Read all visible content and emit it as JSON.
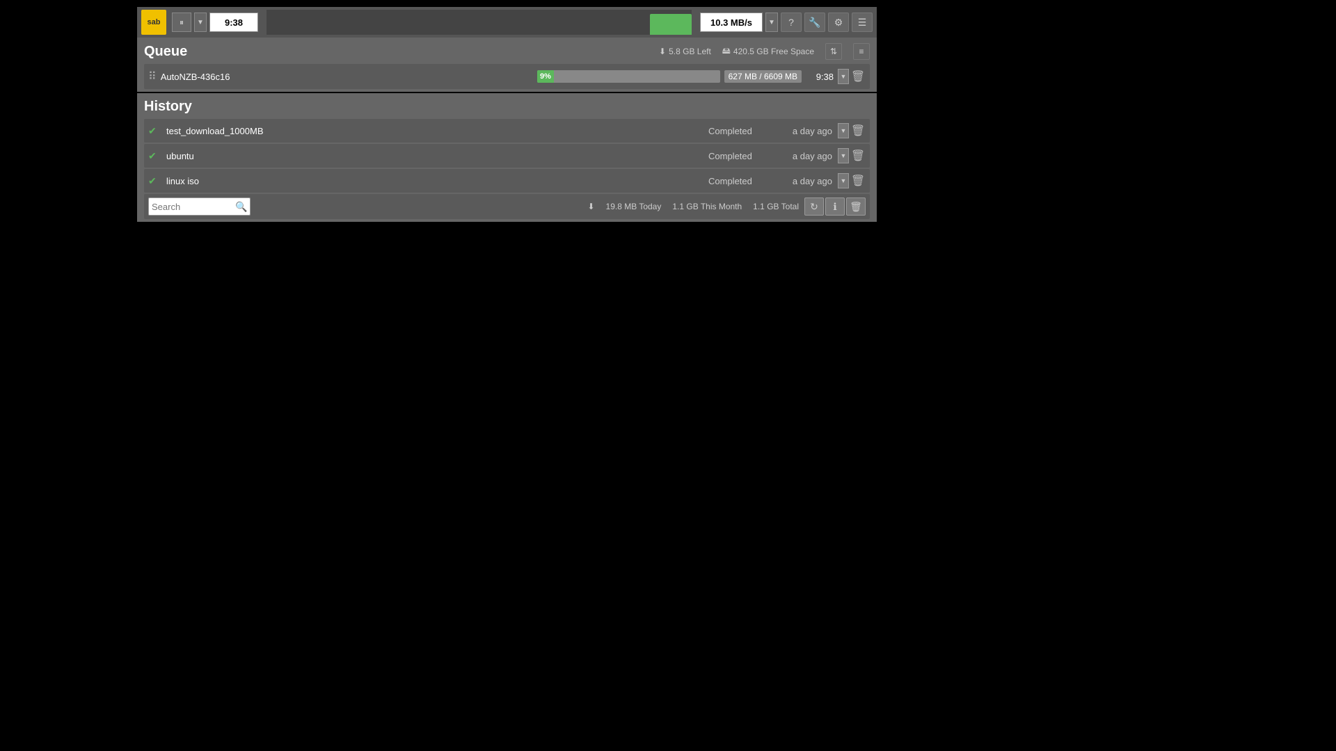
{
  "navbar": {
    "logo_text": "sab",
    "pause_label": "⏸",
    "dropdown_arrow": "▼",
    "time": "9:38",
    "speed": "10.3 MB/s",
    "icons": {
      "help": "?",
      "wrench": "🔧",
      "settings": "⚙",
      "menu": "☰"
    }
  },
  "queue": {
    "title": "Queue",
    "stats": {
      "download_left": "5.8 GB Left",
      "free_space": "420.5 GB Free Space"
    },
    "items": [
      {
        "name": "AutoNZB-436c16",
        "progress_pct": 9,
        "progress_label": "9%",
        "size": "627 MB / 6609 MB",
        "time_left": "9:38"
      }
    ]
  },
  "history": {
    "title": "History",
    "items": [
      {
        "name": "test_download_1000MB",
        "status": "Completed",
        "time": "a day ago"
      },
      {
        "name": "ubuntu",
        "status": "Completed",
        "time": "a day ago"
      },
      {
        "name": "linux iso",
        "status": "Completed",
        "time": "a day ago"
      }
    ],
    "footer": {
      "search_placeholder": "Search",
      "today": "19.8 MB Today",
      "this_month": "1.1 GB This Month",
      "total": "1.1 GB Total"
    }
  }
}
